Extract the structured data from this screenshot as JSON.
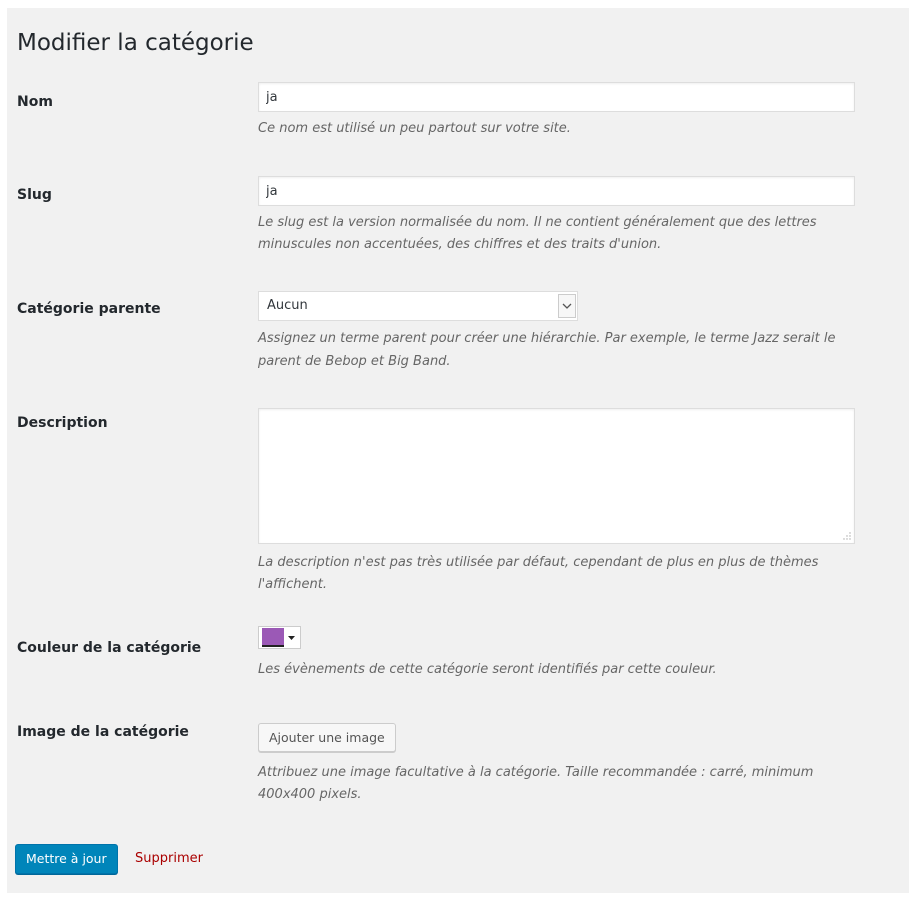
{
  "page": {
    "title": "Modifier la catégorie"
  },
  "fields": {
    "name": {
      "label": "Nom",
      "value": "ja",
      "description": "Ce nom est utilisé un peu partout sur votre site."
    },
    "slug": {
      "label": "Slug",
      "value": "ja",
      "description_line1": "Le slug est la version normalisée du nom. Il ne contient généralement que des lettres",
      "description_line2": "minuscules non accentuées, des chiffres et des traits d'union."
    },
    "parent": {
      "label": "Catégorie parente",
      "selected": "Aucun",
      "description_line1": "Assignez un terme parent pour créer une hiérarchie. Par exemple, le terme Jazz serait le",
      "description_line2": "parent de Bebop et Big Band."
    },
    "description": {
      "label": "Description",
      "value": "",
      "description_line1": "La description n'est pas très utilisée par défaut, cependant de plus en plus de thèmes",
      "description_line2": "l'affichent."
    },
    "color": {
      "label": "Couleur de la catégorie",
      "value": "#9b59b6",
      "description": "Les évènements de cette catégorie seront identifiés par cette couleur."
    },
    "image": {
      "label": "Image de la catégorie",
      "button_label": "Ajouter une image",
      "description_line1": "Attribuez une image facultative à la catégorie. Taille recommandée : carré, minimum",
      "description_line2": "400x400 pixels."
    }
  },
  "actions": {
    "submit_label": "Mettre à jour",
    "delete_label": "Supprimer"
  },
  "icons": {
    "select_arrow": "chevron-down-icon",
    "color_caret": "caret-down-icon",
    "textarea_grip": "resize-grip-icon"
  }
}
